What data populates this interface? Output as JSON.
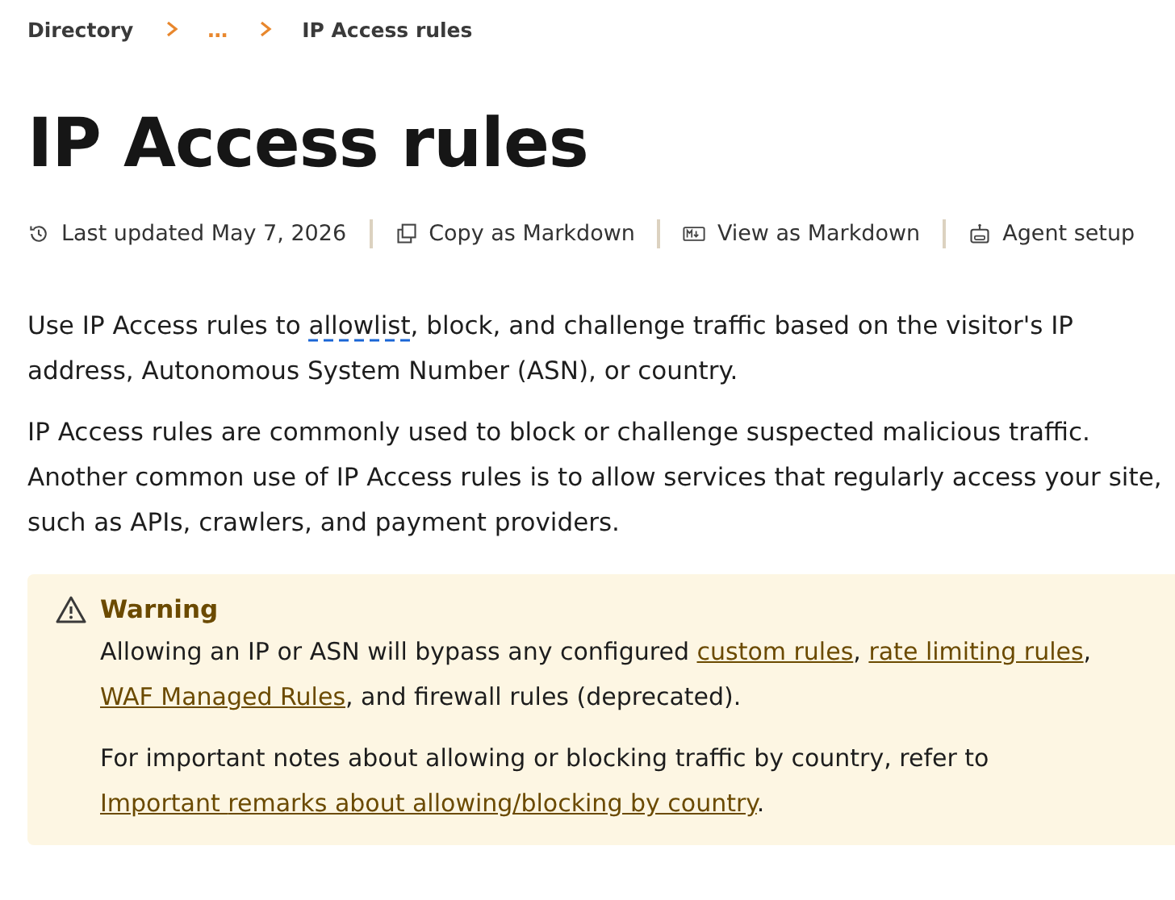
{
  "breadcrumb": [
    {
      "label": "Directory",
      "kind": "link"
    },
    {
      "label": "…",
      "kind": "ellipsis"
    },
    {
      "label": "IP Access rules",
      "kind": "current"
    }
  ],
  "title": "IP Access rules",
  "meta": [
    {
      "kind": "history",
      "label": "Last updated May 7, 2026"
    },
    {
      "kind": "copy",
      "label": "Copy as Markdown"
    },
    {
      "kind": "markdown",
      "label": "View as Markdown"
    },
    {
      "kind": "agent",
      "label": "Agent setup"
    }
  ],
  "paragraphs": [
    [
      {
        "kind": "text",
        "text": "Use IP Access rules to "
      },
      {
        "kind": "term",
        "text": "allowlist"
      },
      {
        "kind": "text",
        "text": ", block, and challenge traffic based on the visitor's IP address, Autonomous System Number (ASN), or country."
      }
    ],
    [
      {
        "kind": "text",
        "text": "IP Access rules are commonly used to block or challenge suspected malicious traffic. Another common use of IP Access rules is to allow services that regularly access your site, such as APIs, crawlers, and payment providers."
      }
    ]
  ],
  "warning": {
    "title": "Warning",
    "paragraphs": [
      [
        {
          "kind": "text",
          "text": "Allowing an IP or ASN will bypass any configured "
        },
        {
          "kind": "link",
          "text": "custom rules"
        },
        {
          "kind": "text",
          "text": ", "
        },
        {
          "kind": "link",
          "text": "rate limiting rules"
        },
        {
          "kind": "text",
          "text": ", "
        },
        {
          "kind": "link",
          "text": "WAF Managed Rules"
        },
        {
          "kind": "text",
          "text": ", and firewall rules (deprecated)."
        }
      ],
      [
        {
          "kind": "text",
          "text": "For important notes about allowing or blocking traffic by country, refer to "
        },
        {
          "kind": "link",
          "text": "Important "
        },
        {
          "kind": "link",
          "text": "remarks about allowing/blocking by country"
        },
        {
          "kind": "text",
          "text": "."
        }
      ]
    ]
  }
}
